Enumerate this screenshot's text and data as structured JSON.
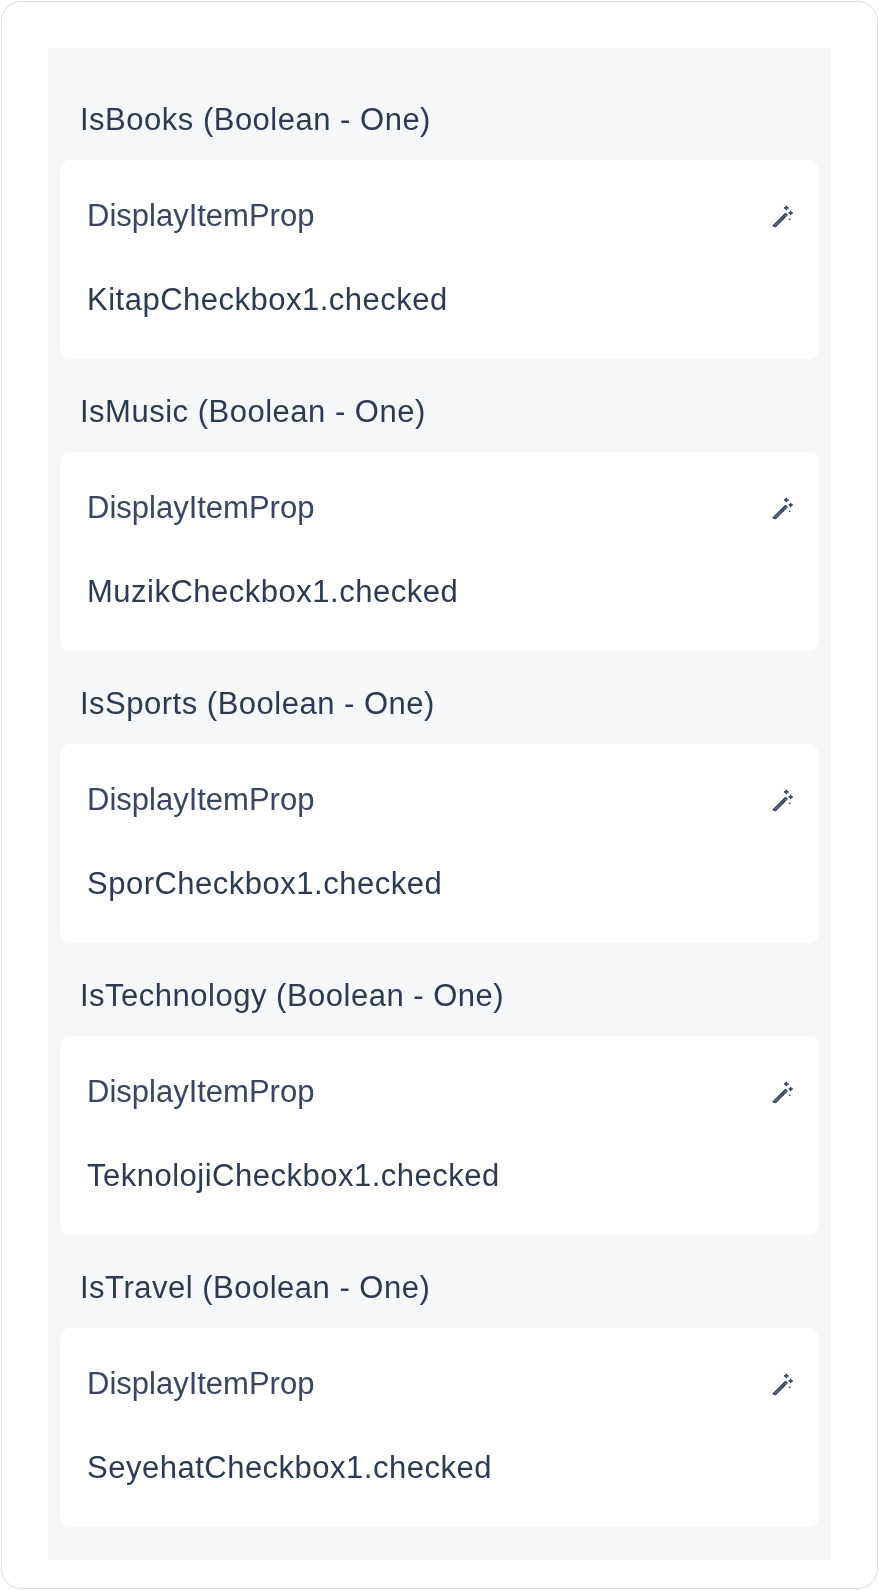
{
  "properties": [
    {
      "title": "IsBooks (Boolean - One)",
      "label": "DisplayItemProp",
      "value": "KitapCheckbox1.checked"
    },
    {
      "title": "IsMusic (Boolean - One)",
      "label": "DisplayItemProp",
      "value": "MuzikCheckbox1.checked"
    },
    {
      "title": "IsSports (Boolean - One)",
      "label": "DisplayItemProp",
      "value": "SporCheckbox1.checked"
    },
    {
      "title": "IsTechnology (Boolean - One)",
      "label": "DisplayItemProp",
      "value": "TeknolojiCheckbox1.checked"
    },
    {
      "title": "IsTravel (Boolean - One)",
      "label": "DisplayItemProp",
      "value": "SeyehatCheckbox1.checked"
    }
  ]
}
